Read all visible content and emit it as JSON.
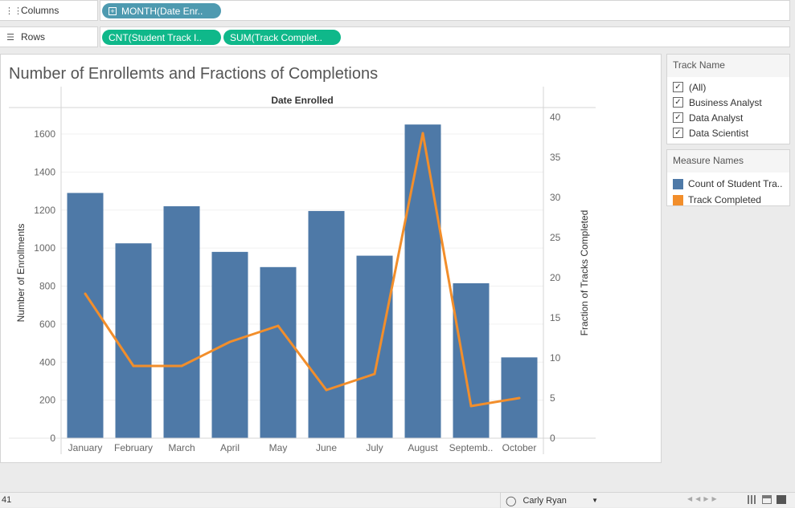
{
  "shelves": {
    "columns": {
      "label": "Columns",
      "icon": "columns-icon",
      "pills": [
        "MONTH(Date Enr.."
      ]
    },
    "rows": {
      "label": "Rows",
      "icon": "rows-icon",
      "pills": [
        "CNT(Student Track I..",
        "SUM(Track Complet.."
      ]
    }
  },
  "chart_data": {
    "type": "bar",
    "title": "Number of Enrollemts and Fractions of Completions",
    "header": "Date Enrolled",
    "categories": [
      "January",
      "February",
      "March",
      "April",
      "May",
      "June",
      "July",
      "August",
      "Septemb..",
      "October"
    ],
    "series": [
      {
        "name": "Count of Student Tra..",
        "type": "bar",
        "axis": "left",
        "color": "#4e79a7",
        "values": [
          1290,
          1025,
          1220,
          980,
          900,
          1195,
          960,
          1650,
          815,
          425
        ]
      },
      {
        "name": "Track Completed",
        "type": "line",
        "axis": "right",
        "color": "#f28e2b",
        "values": [
          18,
          9,
          9,
          12,
          14,
          6,
          8,
          38,
          4,
          5
        ]
      }
    ],
    "ylabel": "Number of Enrollments",
    "ylim": [
      0,
      1700
    ],
    "yticks": [
      0,
      200,
      400,
      600,
      800,
      1000,
      1200,
      1400,
      1600
    ],
    "y2label": "Fraction of Tracks Completed",
    "y2lim": [
      0,
      42
    ],
    "y2ticks": [
      0,
      5,
      10,
      15,
      20,
      25,
      30,
      35,
      40
    ],
    "grid": true,
    "legend": "right"
  },
  "filters": {
    "track_name": {
      "title": "Track Name",
      "items": [
        {
          "label": "(All)",
          "checked": true
        },
        {
          "label": "Business Analyst",
          "checked": true
        },
        {
          "label": "Data Analyst",
          "checked": true
        },
        {
          "label": "Data Scientist",
          "checked": true
        }
      ]
    },
    "measure_names": {
      "title": "Measure Names",
      "items": [
        {
          "label": "Count of Student Tra..",
          "color": "#4e79a7"
        },
        {
          "label": "Track Completed",
          "color": "#f28e2b"
        }
      ]
    }
  },
  "status": {
    "marks": "41",
    "user": "Carly Ryan"
  }
}
